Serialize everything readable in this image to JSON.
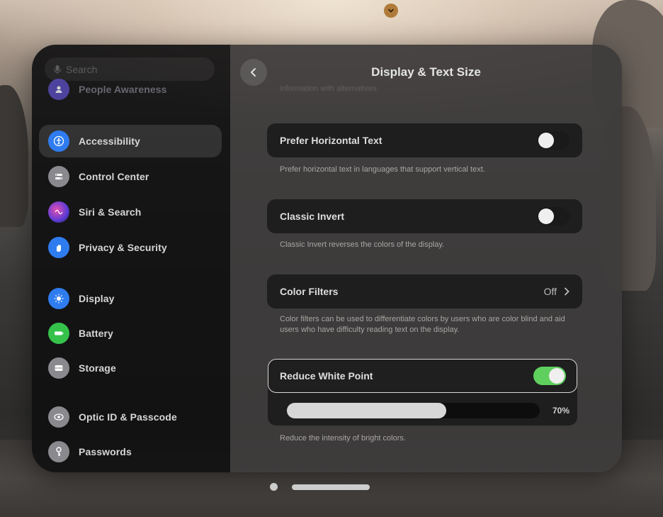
{
  "search": {
    "placeholder": "Search"
  },
  "sidebar": {
    "items": [
      {
        "label": "People Awareness",
        "icon": "people-awareness-icon",
        "color": "#6a5ad0"
      },
      {
        "label": "Accessibility",
        "icon": "accessibility-icon",
        "color": "#2f7cf0",
        "selected": true
      },
      {
        "label": "Control Center",
        "icon": "control-center-icon",
        "color": "#8a8a8e"
      },
      {
        "label": "Siri & Search",
        "icon": "siri-icon",
        "color": "#8a4fd6"
      },
      {
        "label": "Privacy & Security",
        "icon": "hand-icon",
        "color": "#2f7cf0"
      },
      {
        "label": "Display",
        "icon": "sun-icon",
        "color": "#2f7cf0"
      },
      {
        "label": "Battery",
        "icon": "battery-icon",
        "color": "#35c24b"
      },
      {
        "label": "Storage",
        "icon": "storage-icon",
        "color": "#8a8a8e"
      },
      {
        "label": "Optic ID & Passcode",
        "icon": "optic-id-icon",
        "color": "#8a8a8e"
      },
      {
        "label": "Passwords",
        "icon": "key-icon",
        "color": "#8a8a8e"
      }
    ]
  },
  "main": {
    "title": "Display & Text Size",
    "top_note": "information with alternatives.",
    "prefer_horizontal": {
      "label": "Prefer Horizontal Text",
      "on": false,
      "description": "Prefer horizontal text in languages that support vertical text."
    },
    "classic_invert": {
      "label": "Classic Invert",
      "on": false,
      "description": "Classic Invert reverses the colors of the display."
    },
    "color_filters": {
      "label": "Color Filters",
      "value": "Off",
      "description": "Color filters can be used to differentiate colors by users who are color blind and aid users who have difficulty reading text on the display."
    },
    "reduce_white_point": {
      "label": "Reduce White Point",
      "on": true,
      "value_label": "70%",
      "value": 0.7,
      "description": "Reduce the intensity of bright colors."
    }
  },
  "colors": {
    "toggle_on": "#5fcf5e",
    "accent_top": "#b07b3a"
  }
}
